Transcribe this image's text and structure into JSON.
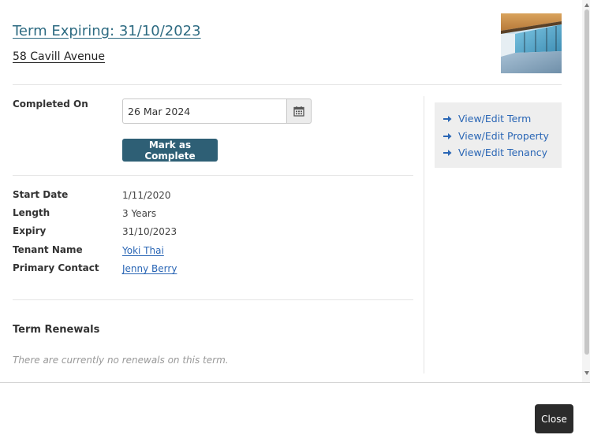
{
  "header": {
    "title": "Term Expiring: 31/10/2023",
    "address": "58 Cavill Avenue"
  },
  "completion": {
    "label": "Completed On",
    "date_value": "26 Mar 2024",
    "button_label": "Mark as Complete"
  },
  "details": [
    {
      "label": "Start Date",
      "value": "1/11/2020",
      "is_link": false
    },
    {
      "label": "Length",
      "value": "3 Years",
      "is_link": false
    },
    {
      "label": "Expiry",
      "value": "31/10/2023",
      "is_link": false
    },
    {
      "label": "Tenant Name",
      "value": "Yoki Thai",
      "is_link": true
    },
    {
      "label": "Primary Contact",
      "value": "Jenny Berry",
      "is_link": true
    }
  ],
  "renewals": {
    "heading": "Term Renewals",
    "empty_message": "There are currently no renewals on this term."
  },
  "sidebar": {
    "links": [
      {
        "label": "View/Edit Term",
        "icon": "arrow-right-icon"
      },
      {
        "label": "View/Edit Property",
        "icon": "arrow-right-icon"
      },
      {
        "label": "View/Edit Tenancy",
        "icon": "arrow-right-icon"
      }
    ]
  },
  "footer": {
    "close_label": "Close"
  },
  "colors": {
    "link": "#2a66b5",
    "title": "#2e6b82",
    "primary_button": "#2e5f75",
    "close_button": "#2b2b2b"
  }
}
